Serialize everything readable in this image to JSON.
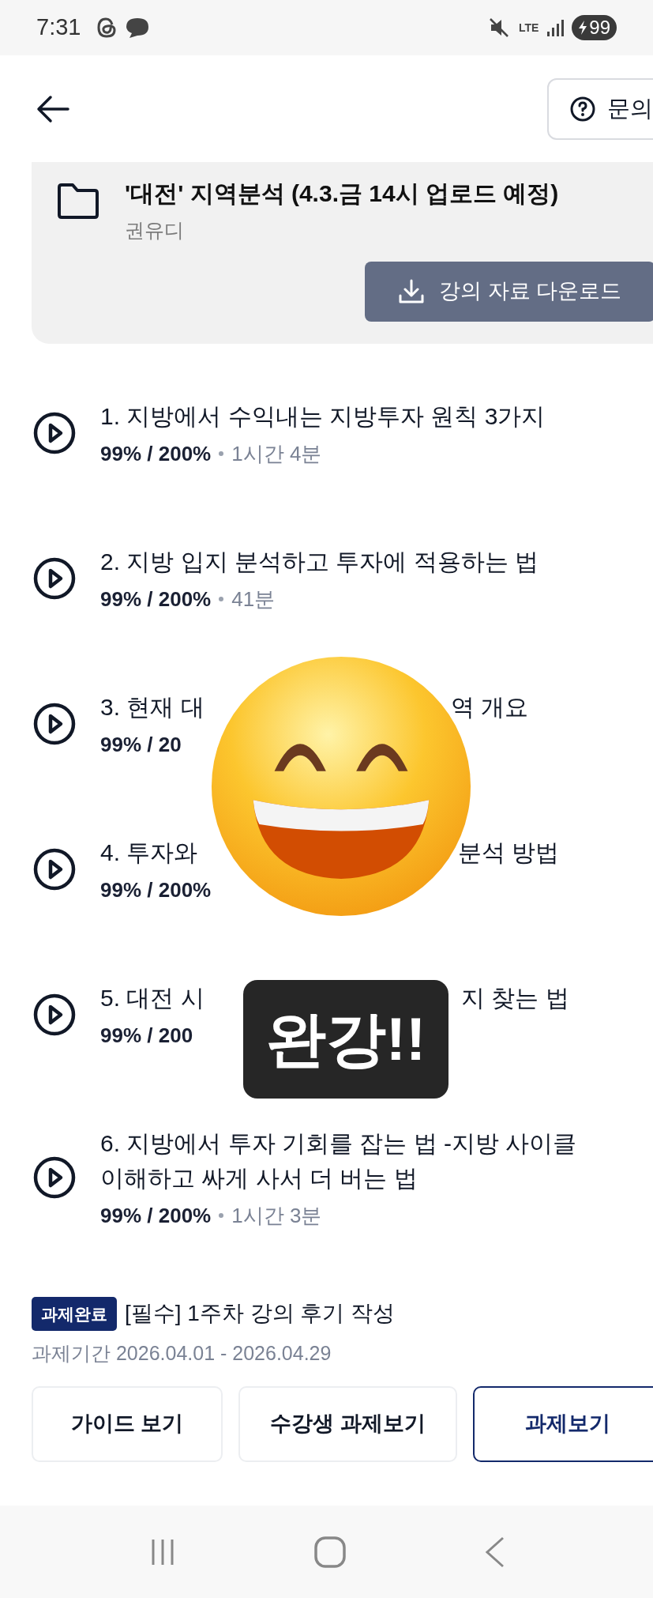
{
  "status_bar": {
    "time": "7:31",
    "network": "LTE",
    "battery": "99"
  },
  "header": {
    "inquiry_button": "문의"
  },
  "material": {
    "title": "'대전' 지역분석 (4.3.금 14시 업로드 예정)",
    "author": "권유디",
    "download_button": "강의 자료 다운로드"
  },
  "lectures": [
    {
      "title_parts": [
        "1. 지방에서 수익내는 지방투자 원칙 3가지"
      ],
      "progress": "99% / 200%",
      "duration": "1시간 4분"
    },
    {
      "title_parts": [
        "2. 지방 입지 분석하고 투자에 적용하는 법"
      ],
      "progress": "99% / 200%",
      "duration": "41분"
    },
    {
      "title_parts": [
        "3. 현재 대",
        "역 개요"
      ],
      "progress": "99% / 20"
    },
    {
      "title_parts": [
        "4. 투자와",
        "분석 방법"
      ],
      "progress": "99% / 200%"
    },
    {
      "title_parts": [
        "5. 대전 시",
        "지 찾는 법"
      ],
      "progress": "99% / 200"
    },
    {
      "title_parts": [
        "6. 지방에서 투자 기회를 잡는 법 -지방 사이클",
        "이해하고 싸게 사서 더 버는 법"
      ],
      "progress": "99% / 200%",
      "duration": "1시간 3분"
    }
  ],
  "assignment": {
    "badge": "과제완료",
    "title": "[필수] 1주차 강의 후기 작성",
    "period": "과제기간 2026.04.01 - 2026.04.29",
    "buttons": [
      {
        "label": "가이드 보기",
        "selected": false
      },
      {
        "label": "수강생 과제보기",
        "selected": false
      },
      {
        "label": "과제보기",
        "selected": true
      }
    ]
  },
  "stickers": [
    {
      "kind": "emoji"
    },
    {
      "kind": "text",
      "text": "완강!!"
    }
  ]
}
